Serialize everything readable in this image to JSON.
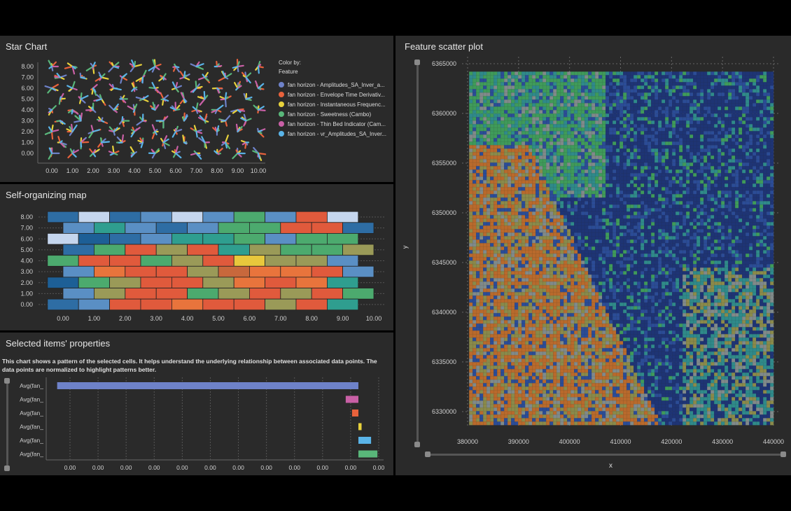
{
  "star_chart": {
    "title": "Star Chart",
    "color_by_label": "Color by:",
    "color_by_value": "Feature",
    "legend": [
      {
        "label": "fan horizon - Amplitudes_SA_Inver_a...",
        "color": "#6e82c9"
      },
      {
        "label": "fan horizon - Envelope Time Derivativ...",
        "color": "#e8623c"
      },
      {
        "label": "fan horizon - Instantaneous Frequenc...",
        "color": "#e8d23c"
      },
      {
        "label": "fan horizon - Sweetness (Cambo)",
        "color": "#59b77a"
      },
      {
        "label": "fan horizon - Thin Bed Indicator (Cam...",
        "color": "#c960a6"
      },
      {
        "label": "fan horizon - vr_Amplitudes_SA_Inver...",
        "color": "#5ab4e8"
      }
    ],
    "x_ticks": [
      "0.00",
      "1.00",
      "2.00",
      "3.00",
      "4.00",
      "5.00",
      "6.00",
      "7.00",
      "8.00",
      "9.00",
      "10.00"
    ],
    "y_ticks": [
      "8.00",
      "7.00",
      "6.00",
      "5.00",
      "4.00",
      "3.00",
      "2.00",
      "1.00",
      "0.00"
    ]
  },
  "som": {
    "title": "Self-organizing map",
    "x_ticks": [
      "0.00",
      "1.00",
      "2.00",
      "3.00",
      "4.00",
      "5.00",
      "6.00",
      "7.00",
      "8.00",
      "9.00",
      "10.00"
    ],
    "y_ticks": [
      "8.00",
      "7.00",
      "6.00",
      "5.00",
      "4.00",
      "3.00",
      "2.00",
      "1.00",
      "0.00"
    ],
    "palette": [
      "#2e6da4",
      "#5a8fc4",
      "#c5d6ee",
      "#e05a3c",
      "#4caa6e",
      "#2f9e8f",
      "#e8743c",
      "#9a9a58",
      "#c8683c",
      "#e8c83c",
      "#1d5f96"
    ],
    "rows": [
      [
        0,
        2,
        0,
        1,
        2,
        1,
        4,
        1,
        3,
        2
      ],
      [
        1,
        5,
        1,
        0,
        1,
        4,
        4,
        3,
        3,
        0
      ],
      [
        2,
        10,
        0,
        1,
        5,
        5,
        4,
        1,
        4,
        4
      ],
      [
        0,
        4,
        3,
        7,
        3,
        5,
        7,
        4,
        4,
        7
      ],
      [
        4,
        3,
        3,
        4,
        7,
        3,
        9,
        7,
        7,
        1
      ],
      [
        1,
        6,
        3,
        3,
        7,
        8,
        6,
        6,
        3,
        1
      ],
      [
        10,
        4,
        7,
        3,
        3,
        7,
        6,
        3,
        6,
        5
      ],
      [
        1,
        7,
        3,
        3,
        4,
        7,
        3,
        7,
        3,
        4
      ],
      [
        0,
        1,
        3,
        3,
        6,
        3,
        3,
        7,
        3,
        5
      ],
      [
        2,
        4,
        1,
        8,
        3,
        1,
        4,
        5,
        3,
        3
      ]
    ]
  },
  "selected": {
    "title": "Selected items' properties",
    "description": "This chart shows a pattern of the selected cells. It helps understand the underlying relationship between associated data points. The data points are normalized to highlight patterns better.",
    "bars": [
      {
        "label": "Avg(fan_",
        "value": -0.95,
        "color": "#6e82c9"
      },
      {
        "label": "Avg(fan_",
        "value": -0.04,
        "color": "#c960a6"
      },
      {
        "label": "Avg(fan_",
        "value": -0.02,
        "color": "#e8623c"
      },
      {
        "label": "Avg(fan_",
        "value": 0.01,
        "color": "#e8d23c"
      },
      {
        "label": "Avg(fan_",
        "value": 0.04,
        "color": "#5ab4e8"
      },
      {
        "label": "Avg(fan_",
        "value": 0.06,
        "color": "#59b77a"
      }
    ],
    "x_ticks": [
      "0.00",
      "0.00",
      "0.00",
      "0.00",
      "0.00",
      "0.00",
      "0.00",
      "0.00",
      "0.00",
      "0.00",
      "0.00",
      "0.00"
    ]
  },
  "scatter": {
    "title": "Feature scatter plot",
    "x_label": "x",
    "y_label": "y",
    "x_ticks": [
      "380000",
      "390000",
      "400000",
      "410000",
      "420000",
      "430000",
      "440000"
    ],
    "y_ticks": [
      "6365000",
      "6360000",
      "6355000",
      "6350000",
      "6345000",
      "6340000",
      "6335000",
      "6330000"
    ],
    "colors": {
      "deep": "#1e3475",
      "blue": "#2b4c96",
      "teal": "#2f8a8a",
      "green": "#3f9a5a",
      "orange": "#b86a2c",
      "gray": "#808a8a",
      "olive": "#8a8a4a"
    }
  },
  "chart_data": [
    {
      "type": "scatter",
      "title": "Star Chart",
      "xlim": [
        0,
        10
      ],
      "ylim": [
        0,
        8
      ],
      "series": [
        {
          "name": "fan horizon - Amplitudes_SA_Inver_a..."
        },
        {
          "name": "fan horizon - Envelope Time Derivativ..."
        },
        {
          "name": "fan horizon - Instantaneous Frequenc..."
        },
        {
          "name": "fan horizon - Sweetness (Cambo)"
        },
        {
          "name": "fan horizon - Thin Bed Indicator (Cam..."
        },
        {
          "name": "fan horizon - vr_Amplitudes_SA_Inver..."
        }
      ]
    },
    {
      "type": "heatmap",
      "title": "Self-organizing map",
      "xlim": [
        0,
        10
      ],
      "ylim": [
        0,
        8
      ]
    },
    {
      "type": "bar",
      "title": "Selected items' properties",
      "categories": [
        "Avg(fan_",
        "Avg(fan_",
        "Avg(fan_",
        "Avg(fan_",
        "Avg(fan_",
        "Avg(fan_"
      ],
      "values": [
        -0.95,
        -0.04,
        -0.02,
        0.01,
        0.04,
        0.06
      ]
    },
    {
      "type": "scatter",
      "title": "Feature scatter plot",
      "xlabel": "x",
      "ylabel": "y",
      "xlim": [
        378000,
        441000
      ],
      "ylim": [
        6328000,
        6366000
      ]
    }
  ]
}
